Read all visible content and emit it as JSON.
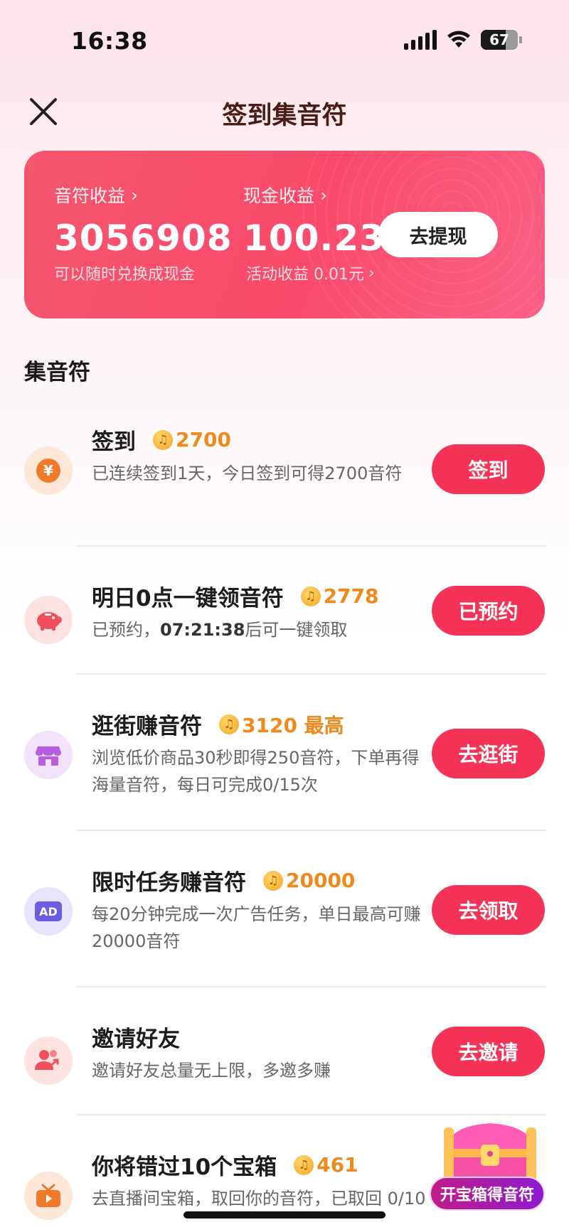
{
  "status_bar": {
    "time": "16:38",
    "battery": "67"
  },
  "header": {
    "title": "签到集音符"
  },
  "earnings": {
    "notes_label": "音符收益",
    "notes_value": "3056908",
    "notes_sub": "可以随时兑换成现金",
    "cash_label": "现金收益",
    "cash_value": "100.23",
    "cash_sub": "活动收益 0.01元",
    "withdraw_button": "去提现"
  },
  "section_title": "集音符",
  "tasks": [
    {
      "title": "签到",
      "reward": "2700",
      "desc": "已连续签到1天，今日签到可得2700音符",
      "button": "签到",
      "icon": "yuan-coin-icon"
    },
    {
      "title": "明日0点一键领音符",
      "reward": "2778",
      "desc_prefix": "已预约，",
      "desc_time": "07:21:38",
      "desc_suffix": "后可一键领取",
      "button": "已预约",
      "icon": "piggy-bank-icon"
    },
    {
      "title": "逛街赚音符",
      "reward": "3120 最高",
      "desc": "浏览低价商品30秒即得250音符，下单再得海量音符，每日可完成0/15次",
      "button": "去逛街",
      "icon": "shop-icon"
    },
    {
      "title": "限时任务赚音符",
      "reward": "20000",
      "desc": "每20分钟完成一次广告任务，单日最高可赚20000音符",
      "button": "去领取",
      "icon": "ad-icon",
      "icon_text": "AD"
    },
    {
      "title": "邀请好友",
      "desc": "邀请好友总量无上限，多邀多赚",
      "button": "去邀请",
      "icon": "invite-friends-icon"
    },
    {
      "title": "你将错过10个宝箱",
      "reward": "461",
      "desc": "去直播间宝箱，取回你的音符，已取回 0/10",
      "icon": "live-tv-icon"
    }
  ],
  "floating_chest": {
    "label": "开宝箱得音符"
  },
  "colors": {
    "accent": "#f43356",
    "reward": "#ee8a1c",
    "title": "#4a1c14"
  }
}
